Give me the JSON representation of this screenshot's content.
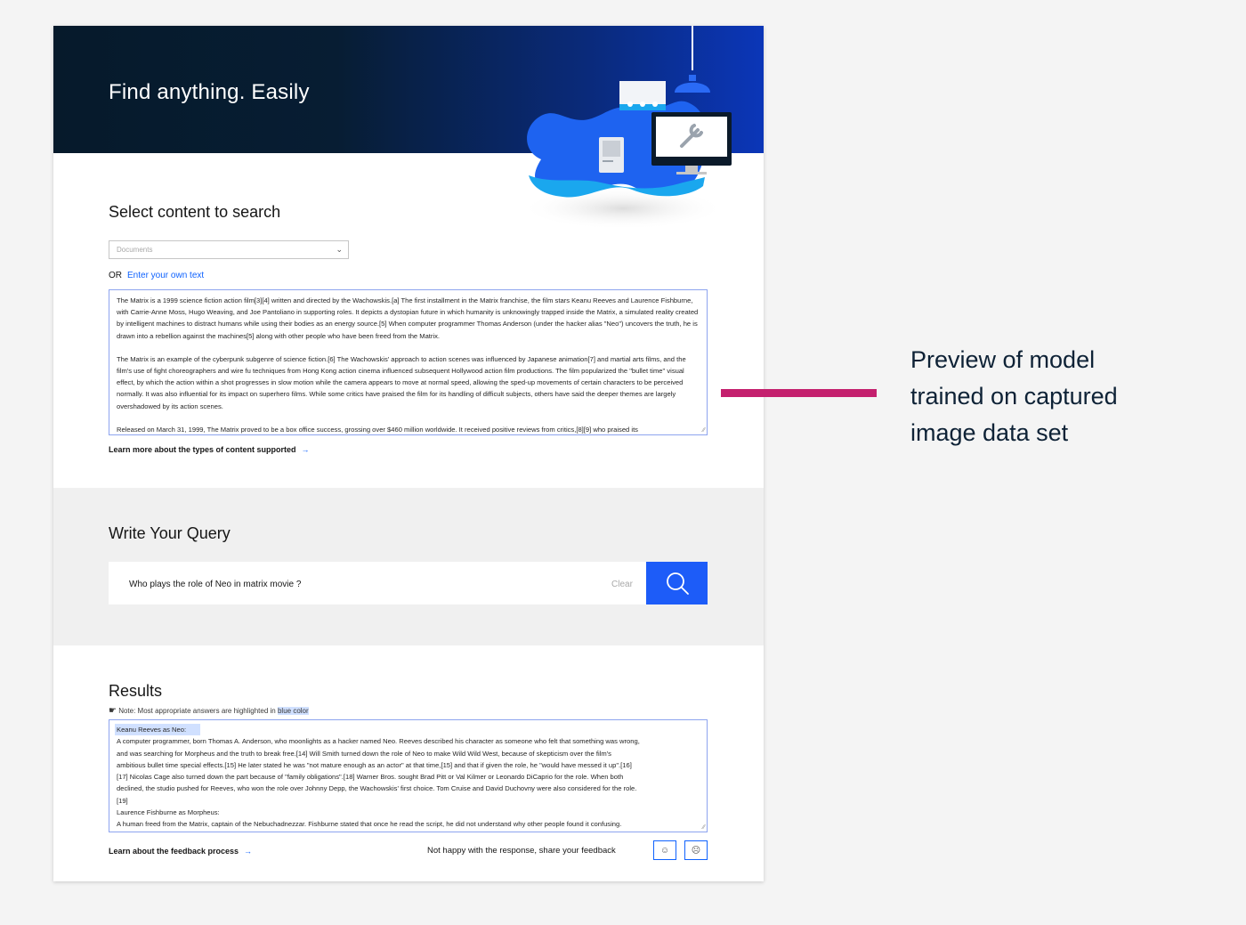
{
  "hero": {
    "title": "Find anything. Easily"
  },
  "content_section": {
    "title": "Select content to search",
    "select_value": "Documents",
    "or_label": "OR",
    "own_text_link": "Enter your own text",
    "document_paragraphs": [
      "The Matrix is a 1999 science fiction action film[3][4] written and directed by the Wachowskis.[a] The first installment in the Matrix franchise, the film stars Keanu Reeves and Laurence Fishburne, with Carrie-Anne Moss, Hugo Weaving, and Joe Pantoliano in supporting roles. It depicts a dystopian future in which humanity is unknowingly trapped inside the Matrix, a simulated reality created by intelligent machines to distract humans while using their bodies as an energy source.[5] When computer programmer Thomas Anderson (under the hacker alias \"Neo\") uncovers the truth, he is drawn into a rebellion against the machines[5] along with other people who have been freed from the Matrix.",
      "The Matrix is an example of the cyberpunk subgenre of science fiction.[6] The Wachowskis' approach to action scenes was influenced by Japanese animation[7] and martial arts films, and the film's use of fight choreographers and wire fu techniques from Hong Kong action cinema influenced subsequent Hollywood action film productions. The film popularized the \"bullet time\" visual effect, by which the action within a shot progresses in slow motion while the camera appears to move at normal speed, allowing the sped-up movements of certain characters to be perceived normally. It was also influential for its impact on superhero films. While some critics have praised the film for its handling of difficult subjects, others have said the deeper themes are largely overshadowed by its action scenes.",
      "Released on March 31, 1999, The Matrix proved to be a box office success, grossing over $460 million worldwide. It received positive reviews from critics,[8][9] who praised its"
    ],
    "learn_more": "Learn more about the types of content supported"
  },
  "query_section": {
    "title": "Write Your Query",
    "query_value": "Who plays the role of Neo in matrix movie ?",
    "clear_label": "Clear"
  },
  "results_section": {
    "title": "Results",
    "note_prefix": "Note: Most appropriate answers are highlighted in",
    "note_highlight": "blue color",
    "highlight_heading": "Keanu Reeves as Neo:",
    "lines": [
      "A computer programmer, born Thomas A. Anderson, who moonlights as a hacker named Neo. Reeves described his character as someone who felt that something was wrong,",
      "and was searching for Morpheus and the truth to break free.[14] Will Smith turned down the role of Neo to make Wild Wild West, because of skepticism over the film's",
      "ambitious bullet time special effects.[15] He later stated he was \"not mature enough as an actor\" at that time,[15] and that if given the role, he \"would have messed it up\".[16]",
      "[17] Nicolas Cage also turned down the part because of \"family obligations\".[18] Warner Bros. sought Brad Pitt or Val Kilmer or Leonardo DiCaprio for the role. When both",
      "declined, the studio pushed for Reeves, who won the role over Johnny Depp, the Wachowskis' first choice. Tom Cruise and David Duchovny were also considered for the role.",
      "[19]",
      "Laurence Fishburne as Morpheus:",
      "A human freed from the Matrix, captain of the Nebuchadnezzar. Fishburne stated that once he read the script, he did not understand why other people found it confusing."
    ],
    "learn_feedback": "Learn about the feedback process",
    "feedback_prompt": "Not happy with the response, share your feedback"
  },
  "annotation": {
    "lines": [
      "Preview of model",
      "trained on captured",
      "image data set"
    ]
  },
  "colors": {
    "accent": "#0f62fe",
    "search_button": "#1d5cf8",
    "connector": "#c4206e",
    "annotation_text": "#0e2236"
  },
  "icons": {
    "select": "chevron-down-icon",
    "search": "search-icon",
    "note": "pointing-hand-icon",
    "feedback_positive": "smile-icon",
    "feedback_negative": "frown-icon"
  }
}
